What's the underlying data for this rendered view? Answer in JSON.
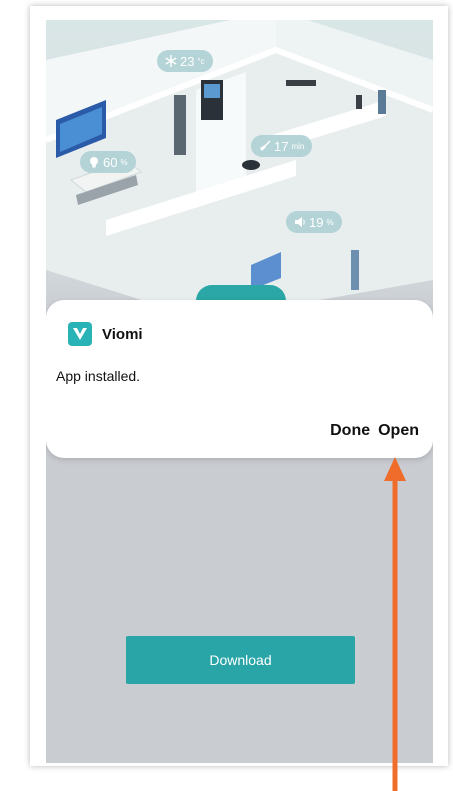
{
  "hero": {
    "badges": {
      "climate": {
        "value": "23",
        "unit": "°c",
        "icon": "snowflake-icon"
      },
      "light": {
        "value": "60",
        "unit": "%",
        "icon": "bulb-icon"
      },
      "cleaning": {
        "value": "17",
        "unit": "min",
        "icon": "broom-icon"
      },
      "volume": {
        "value": "19",
        "unit": "%",
        "icon": "speaker-icon"
      }
    }
  },
  "dialog": {
    "app_name": "Viomi",
    "message": "App installed.",
    "done_label": "Done",
    "open_label": "Open"
  },
  "download_label": "Download",
  "colors": {
    "teal": "#2aa5a7",
    "arrow": "#ef6c2a",
    "screen_bg": "#c9ccd1"
  }
}
